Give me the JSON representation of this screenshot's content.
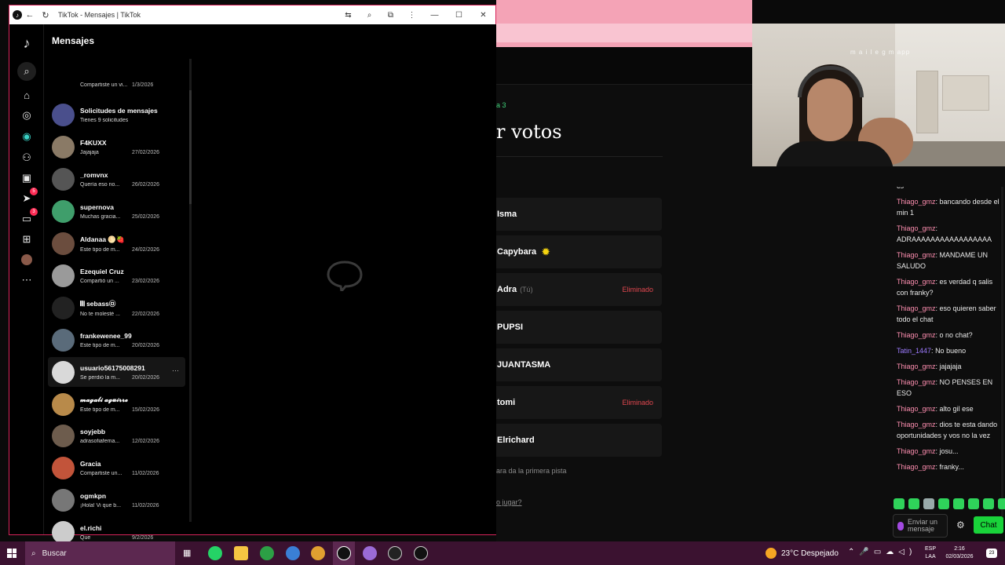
{
  "window": {
    "title": "TikTok - Mensajes | TikTok"
  },
  "panel": {
    "title": "Mensajes"
  },
  "conversations": [
    {
      "name": "",
      "preview": "Compartiste un vi...",
      "date": "1/3/2026",
      "avatar_color": "#000000"
    },
    {
      "name": "Solicitudes de mensajes",
      "preview": "Tienes 9 solicitudes",
      "date": "",
      "avatar_color": "#4a4f8c"
    },
    {
      "name": "F4KUXX",
      "preview": "Jajajaja",
      "date": "27/02/2026",
      "avatar_color": "#8a7a66"
    },
    {
      "name": "_romvnx",
      "preview": "Quería eso no...",
      "date": "26/02/2026",
      "avatar_color": "#555555"
    },
    {
      "name": "supernova",
      "preview": "Muchas gracia...",
      "date": "25/02/2026",
      "avatar_color": "#3f9e6b"
    },
    {
      "name": "Aldanaa 🌕🍓",
      "preview": "Este tipo de m...",
      "date": "24/02/2026",
      "avatar_color": "#6b4d3e"
    },
    {
      "name": "Ezequiel Cruz",
      "preview": "Compartió un ...",
      "date": "23/02/2026",
      "avatar_color": "#9a9a9a"
    },
    {
      "name": "𝄃𝄃𝄂 sebass㉤",
      "preview": "No te molesté ...",
      "date": "22/02/2026",
      "avatar_color": "#222222"
    },
    {
      "name": "frankewenee_99",
      "preview": "Este tipo de m...",
      "date": "20/02/2026",
      "avatar_color": "#5a6b7a"
    },
    {
      "name": "usuario561750082​91",
      "preview": "Se perdió la m...",
      "date": "20/02/2026",
      "avatar_color": "#d9d9d9"
    },
    {
      "name": "𝓶𝓪𝓰𝓪𝓵𝓲 𝓪𝓰𝓾𝓲𝓻𝓻𝓮",
      "preview": "Este tipo de m...",
      "date": "15/02/2026",
      "avatar_color": "#b88a4a"
    },
    {
      "name": "soyjebb",
      "preview": "adrasofiafema...",
      "date": "12/02/2026",
      "avatar_color": "#6d5c4d"
    },
    {
      "name": "Gracia",
      "preview": "Compartiste un...",
      "date": "11/02/2026",
      "avatar_color": "#c2543a"
    },
    {
      "name": "ogmkpn",
      "preview": "¡Hola! Vi que b...",
      "date": "11/02/2026",
      "avatar_color": "#777777"
    },
    {
      "name": "el.richi",
      "preview": "Que",
      "date": "9/2/2026",
      "avatar_color": "#cccccc"
    }
  ],
  "rail_badges": {
    "inbox": "5",
    "messages": "3"
  },
  "page": {
    "small_label": "a 3",
    "heading": "r votos",
    "players": [
      {
        "name": "Isma",
        "tu": "",
        "eliminated": ""
      },
      {
        "name": "Capybara",
        "tu": "",
        "eliminated": "",
        "sun": "✹"
      },
      {
        "name": "Adra",
        "tu": "(Tú)",
        "eliminated": "Eliminado"
      },
      {
        "name": "PUPSI",
        "tu": "",
        "eliminated": ""
      },
      {
        "name": "JUANTASMA",
        "tu": "",
        "eliminated": ""
      },
      {
        "name": "tomi",
        "tu": "",
        "eliminated": "Eliminado"
      },
      {
        "name": "Elrichard",
        "tu": "",
        "eliminated": ""
      }
    ],
    "hint": "ara da la primera pista",
    "link": "o jugar?"
  },
  "webcam": {
    "caption": "m a i l e g    m  app"
  },
  "chat": {
    "messages": [
      {
        "user": "",
        "text": "cs"
      },
      {
        "user": "Thiago_gmz",
        "text": "bancando desde el min 1"
      },
      {
        "user": "Thiago_gmz",
        "text": "ADRAAAAAAAAAAAAAAAAA"
      },
      {
        "user": "Thiago_gmz",
        "text": "MANDAME UN SALUDO"
      },
      {
        "user": "Thiago_gmz",
        "text": "es verdad q salis con franky?"
      },
      {
        "user": "Thiago_gmz",
        "text": "eso quieren saber todo el chat"
      },
      {
        "user": "Thiago_gmz",
        "text": "o no chat?"
      },
      {
        "user": "Tatin_1447",
        "text": "No bueno"
      },
      {
        "user": "Thiago_gmz",
        "text": "jajajaja"
      },
      {
        "user": "Thiago_gmz",
        "text": "NO PENSES EN ESO"
      },
      {
        "user": "Thiago_gmz",
        "text": "alto gil ese"
      },
      {
        "user": "Thiago_gmz",
        "text": "dios te esta dando oportunidades y vos no la vez"
      },
      {
        "user": "Thiago_gmz",
        "text": "josu..."
      },
      {
        "user": "Thiago_gmz",
        "text": "franky..."
      }
    ],
    "input_placeholder": "Enviar un mensaje",
    "send_label": "Chat"
  },
  "taskbar": {
    "search_label": "Buscar",
    "weather": "23°C  Despejado",
    "lang_top": "ESP",
    "lang_bottom": "LAA",
    "time": "2:16",
    "date": "02/03/2026",
    "notifications": "23"
  }
}
